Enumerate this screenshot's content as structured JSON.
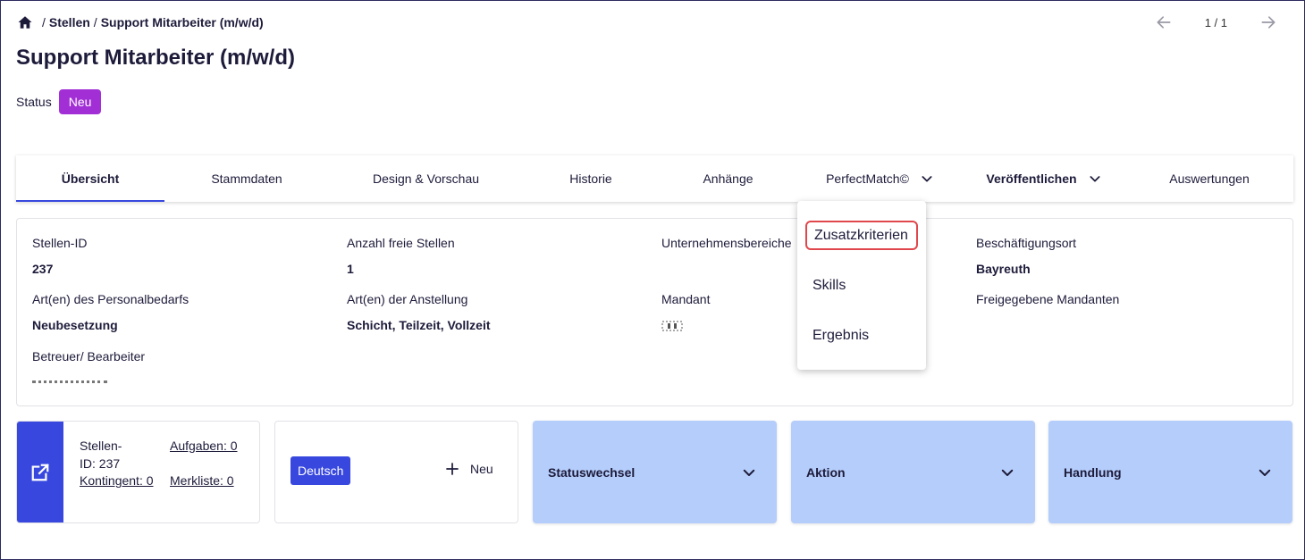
{
  "breadcrumb": {
    "sep": "/",
    "level1": "Stellen",
    "level2": "Support Mitarbeiter (m/w/d)"
  },
  "pager": {
    "count": "1 / 1"
  },
  "page": {
    "title": "Support Mitarbeiter (m/w/d)"
  },
  "status": {
    "label": "Status",
    "value": "Neu",
    "color": "#a22fd6"
  },
  "tabs": [
    {
      "label": "Übersicht"
    },
    {
      "label": "Stammdaten"
    },
    {
      "label": "Design & Vorschau"
    },
    {
      "label": "Historie"
    },
    {
      "label": "Anhänge"
    },
    {
      "label": "PerfectMatch©"
    },
    {
      "label": "Veröffentlichen"
    },
    {
      "label": "Auswertungen"
    }
  ],
  "fields": {
    "stellen_id": {
      "label": "Stellen-ID",
      "value": "237"
    },
    "anzahl": {
      "label": "Anzahl freie Stellen",
      "value": "1"
    },
    "bereich": {
      "label": "Unternehmensbereiche"
    },
    "ort": {
      "label": "Beschäftigungsort",
      "value": "Bayreuth"
    },
    "bedarf": {
      "label": "Art(en) des Personalbedarfs",
      "value": "Neubesetzung"
    },
    "anstellung": {
      "label": "Art(en) der Anstellung",
      "value": "Schicht, Teilzeit, Vollzeit"
    },
    "mandant": {
      "label": "Mandant"
    },
    "freigabe": {
      "label": "Freigegebene Mandanten"
    },
    "betreuer": {
      "label": "Betreuer/ Bearbeiter"
    }
  },
  "dropdown": {
    "items": [
      {
        "label": "Zusatzkriterien"
      },
      {
        "label": "Skills"
      },
      {
        "label": "Ergebnis"
      }
    ]
  },
  "summary": {
    "id_prefix": "Stellen-",
    "id_value": "ID: 237",
    "aufgaben": "Aufgaben: 0",
    "kontingent": "Kontingent: 0",
    "merkliste": "Merkliste: 0"
  },
  "language": {
    "button": "Deutsch",
    "new_label": "Neu"
  },
  "accordions": [
    {
      "label": "Statuswechsel"
    },
    {
      "label": "Aktion"
    },
    {
      "label": "Handlung"
    }
  ],
  "colors": {
    "primary": "#3848de",
    "accordion_bg": "#b5cdfb",
    "highlight": "#e0474c"
  }
}
